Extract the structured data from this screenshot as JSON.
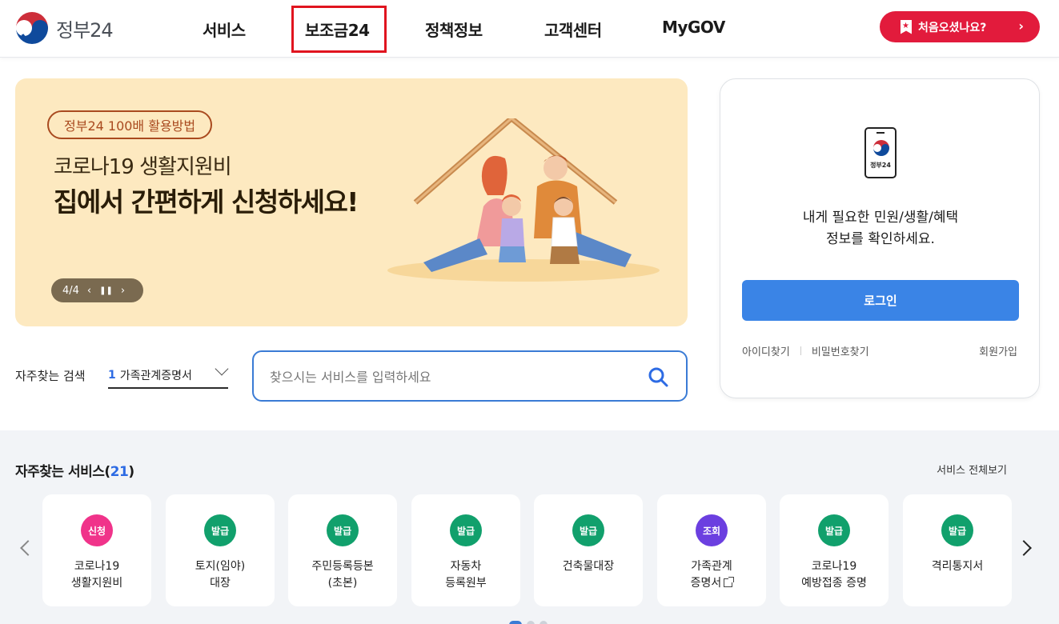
{
  "header": {
    "logo_text": "정부24",
    "nav": [
      {
        "label": "서비스"
      },
      {
        "label": "보조금24"
      },
      {
        "label": "정책정보"
      },
      {
        "label": "고객센터"
      },
      {
        "label": "MyGOV"
      }
    ],
    "first_visit_label": "처음오셨나요?"
  },
  "banner": {
    "pill": "정부24 100배 활용방법",
    "line1": "코로나19 생활지원비",
    "line2": "집에서 간편하게 신청하세요!",
    "slide_counter": "4/4"
  },
  "search": {
    "fav_label": "자주찾는 검색",
    "fav_rank": "1",
    "fav_value": "가족관계증명서",
    "placeholder": "찾으시는 서비스를 입력하세요"
  },
  "login": {
    "phone_label": "정부24",
    "message_line1": "내게 필요한 민원/생활/혜택",
    "message_line2": "정보를 확인하세요.",
    "button": "로그인",
    "find_id": "아이디찾기",
    "find_pw": "비밀번호찾기",
    "signup": "회원가입"
  },
  "frequent": {
    "title": "자주찾는 서비스(",
    "count": "21",
    "title_end": ")",
    "view_all": "서비스 전체보기",
    "items": [
      {
        "badge": "신청",
        "color": "#f0338a",
        "name": "코로나19\n생활지원비"
      },
      {
        "badge": "발급",
        "color": "#11a06c",
        "name": "토지(임야)\n대장"
      },
      {
        "badge": "발급",
        "color": "#11a06c",
        "name": "주민등록등본\n(초본)"
      },
      {
        "badge": "발급",
        "color": "#11a06c",
        "name": "자동차\n등록원부"
      },
      {
        "badge": "발급",
        "color": "#11a06c",
        "name": "건축물대장"
      },
      {
        "badge": "조회",
        "color": "#6b3fe0",
        "name": "가족관계\n증명서"
      },
      {
        "badge": "발급",
        "color": "#11a06c",
        "name": "코로나19\n예방접종 증명"
      },
      {
        "badge": "발급",
        "color": "#11a06c",
        "name": "격리통지서"
      }
    ]
  }
}
